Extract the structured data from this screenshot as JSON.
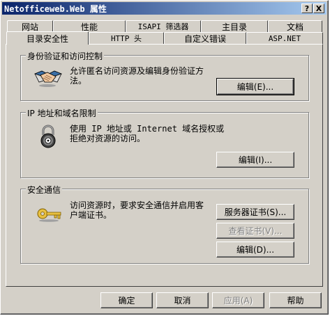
{
  "window": {
    "title": "Netofficeweb.Web 属性"
  },
  "titlebar": {
    "help_glyph": "?",
    "close_glyph": "X"
  },
  "tabs_row_back": [
    "网站",
    "性能",
    "ISAPI 筛选器",
    "主目录",
    "文档"
  ],
  "tabs_row_front": [
    "目录安全性",
    "HTTP 头",
    "自定义错误",
    "ASP.NET"
  ],
  "active_tab": "目录安全性",
  "auth_group": {
    "legend": "身份验证和访问控制",
    "desc_line1": "允许匿名访问资源及编辑身份验证方",
    "desc_line2": "法。",
    "edit_label": "编辑(E)...",
    "icon": "handshake-icon"
  },
  "ip_group": {
    "legend": "IP 地址和域名限制",
    "desc_line1": "使用 IP 地址或 Internet 域名授权或",
    "desc_line2": "拒绝对资源的访问。",
    "edit_label": "编辑(I)...",
    "icon": "padlock-icon"
  },
  "secure_group": {
    "legend": "安全通信",
    "desc_line1": "访问资源时，要求安全通信并启用客",
    "desc_line2": "户端证书。",
    "server_cert_label": "服务器证书(S)...",
    "view_cert_label": "查看证书(V)...",
    "edit_label": "编辑(D)...",
    "icon": "key-icon"
  },
  "footer": {
    "ok_label": "确定",
    "cancel_label": "取消",
    "apply_label": "应用(A)",
    "help_label": "帮助"
  }
}
